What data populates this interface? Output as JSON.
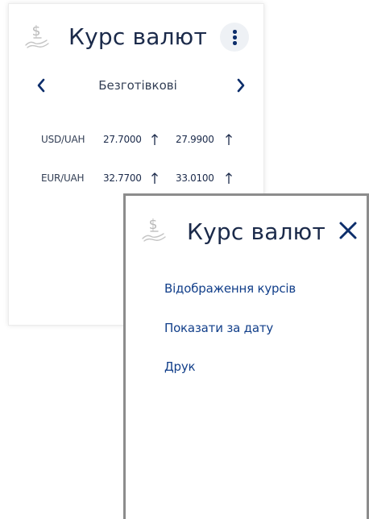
{
  "widget": {
    "title": "Курс валют",
    "mode_label": "Безготівкові",
    "rates": [
      {
        "pair": "USD/UAH",
        "buy": "27.7000",
        "sell": "27.9900"
      },
      {
        "pair": "EUR/UAH",
        "buy": "32.7700",
        "sell": "33.0100"
      }
    ]
  },
  "menu": {
    "title": "Курс валют",
    "items": [
      {
        "label": "Відображення курсів"
      },
      {
        "label": "Показати за дату"
      },
      {
        "label": "Друк"
      }
    ]
  },
  "colors": {
    "title_text": "#1b2a4a",
    "accent_dark_blue": "#0d2e6b",
    "menu_link": "#123f8a",
    "logo_gray": "#b9b9b9",
    "kebab_bg": "#eef1f5",
    "panel_border": "#8c8c8c"
  },
  "icons": {
    "logo": "dollar-hand-icon",
    "more": "kebab-menu-icon",
    "prev": "chevron-left-icon",
    "next": "chevron-right-icon",
    "trend": "arrow-up-icon",
    "close": "close-icon"
  }
}
